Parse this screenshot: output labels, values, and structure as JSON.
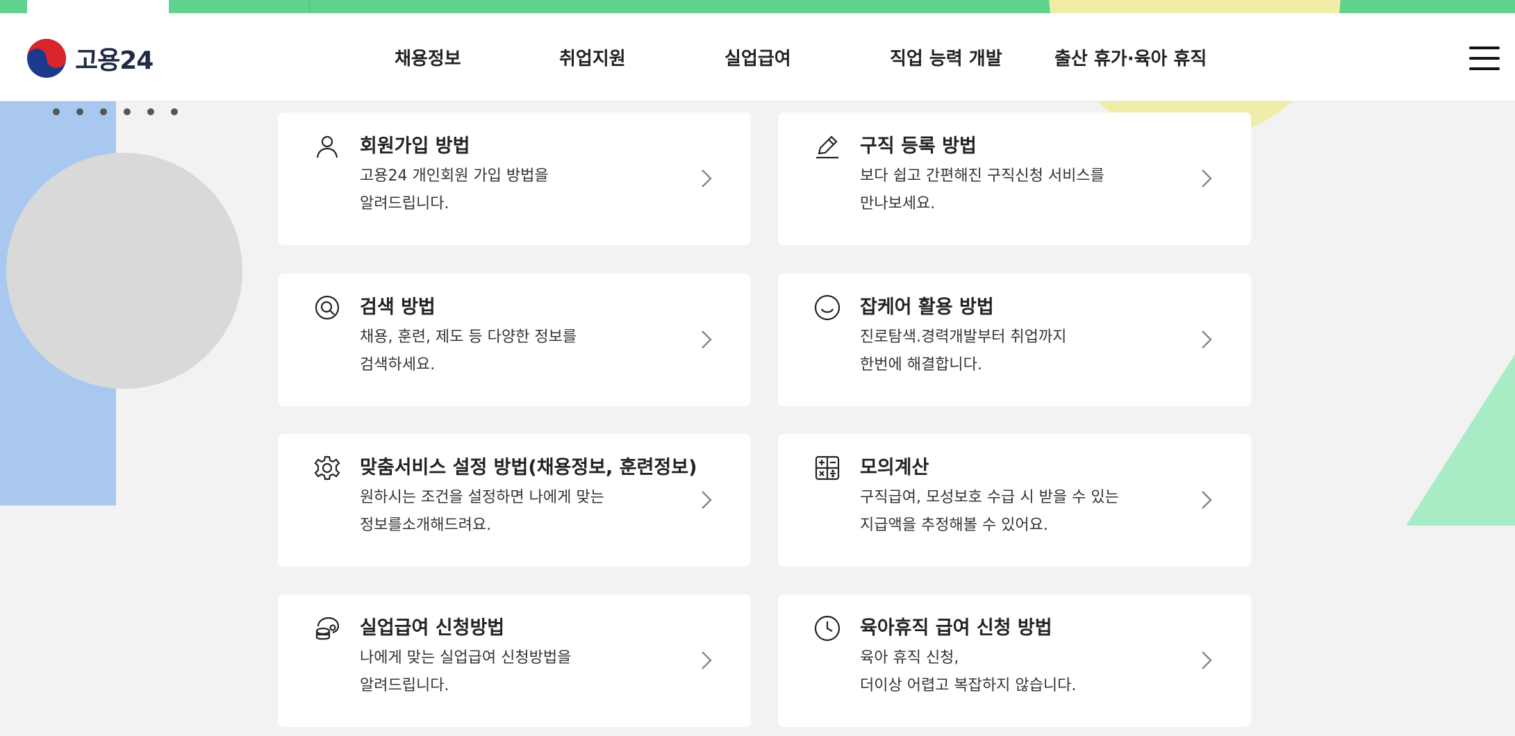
{
  "header": {
    "logo_text": "고용24",
    "nav": [
      "채용정보",
      "취업지원",
      "실업급여",
      "직업 능력 개발",
      "출산 휴가·육아 휴직"
    ]
  },
  "colors": {
    "top_strip": "#5fd38d",
    "accent_blue": "#a9c8ef",
    "accent_yellow": "#efeda8",
    "accent_green": "#a8ecc6"
  },
  "cards": [
    {
      "icon": "person-icon",
      "title": "회원가입 방법",
      "desc1": "고용24 개인회원 가입 방법을",
      "desc2": "알려드립니다."
    },
    {
      "icon": "pencil-icon",
      "title": "구직 등록 방법",
      "desc1": "보다 쉽고 간편해진 구직신청 서비스를",
      "desc2": "만나보세요."
    },
    {
      "icon": "search-icon",
      "title": "검색 방법",
      "desc1": "채용, 훈련, 제도 등 다양한 정보를",
      "desc2": "검색하세요."
    },
    {
      "icon": "smile-icon",
      "title": "잡케어 활용 방법",
      "desc1": "진로탐색.경력개발부터 취업까지",
      "desc2": "한번에 해결합니다."
    },
    {
      "icon": "gear-icon",
      "title": "맞춤서비스 설정 방법(채용정보, 훈련정보)",
      "desc1": "원하시는 조건을 설정하면 나에게 맞는",
      "desc2": "정보를소개해드려요."
    },
    {
      "icon": "calculator-icon",
      "title": "모의계산",
      "desc1": "구직급여, 모성보호 수급 시 받을 수 있는",
      "desc2": "지급액을 추정해볼 수 있어요."
    },
    {
      "icon": "coins-icon",
      "title": "실업급여 신청방법",
      "desc1": "나에게 맞는 실업급여 신청방법을",
      "desc2": "알려드립니다."
    },
    {
      "icon": "clock-icon",
      "title": "육아휴직 급여 신청 방법",
      "desc1": "육아 휴직 신청,",
      "desc2": "더이상 어렵고 복잡하지 않습니다."
    }
  ]
}
